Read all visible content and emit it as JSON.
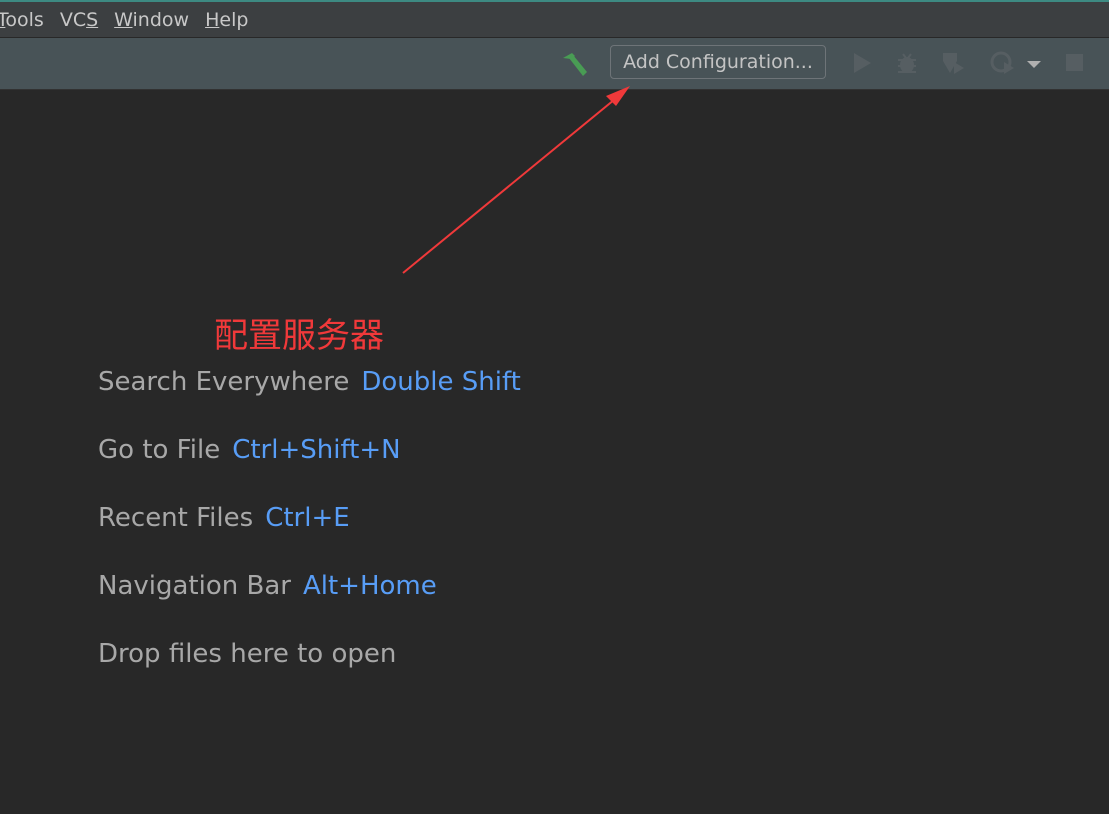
{
  "menu": [
    {
      "label": "Tools",
      "mnemonic_index": 0
    },
    {
      "label": "VCS",
      "mnemonic_index": 2
    },
    {
      "label": "Window",
      "mnemonic_index": 0
    },
    {
      "label": "Help",
      "mnemonic_index": 0
    }
  ],
  "toolbar": {
    "build_icon": "hammer-icon",
    "config_label": "Add Configuration...",
    "icons": [
      "run-icon",
      "debug-icon",
      "coverage-icon",
      "profile-icon",
      "dropdown-icon",
      "stop-icon"
    ]
  },
  "hints": [
    {
      "label": "Search Everywhere",
      "key": "Double Shift"
    },
    {
      "label": "Go to File",
      "key": "Ctrl+Shift+N"
    },
    {
      "label": "Recent Files",
      "key": "Ctrl+E"
    },
    {
      "label": "Navigation Bar",
      "key": "Alt+Home"
    },
    {
      "label": "Drop files here to open",
      "key": ""
    }
  ],
  "annotation": {
    "text": "配置服务器",
    "color": "#f0393a"
  },
  "colors": {
    "accent": "#589df6",
    "build": "#499c54"
  }
}
